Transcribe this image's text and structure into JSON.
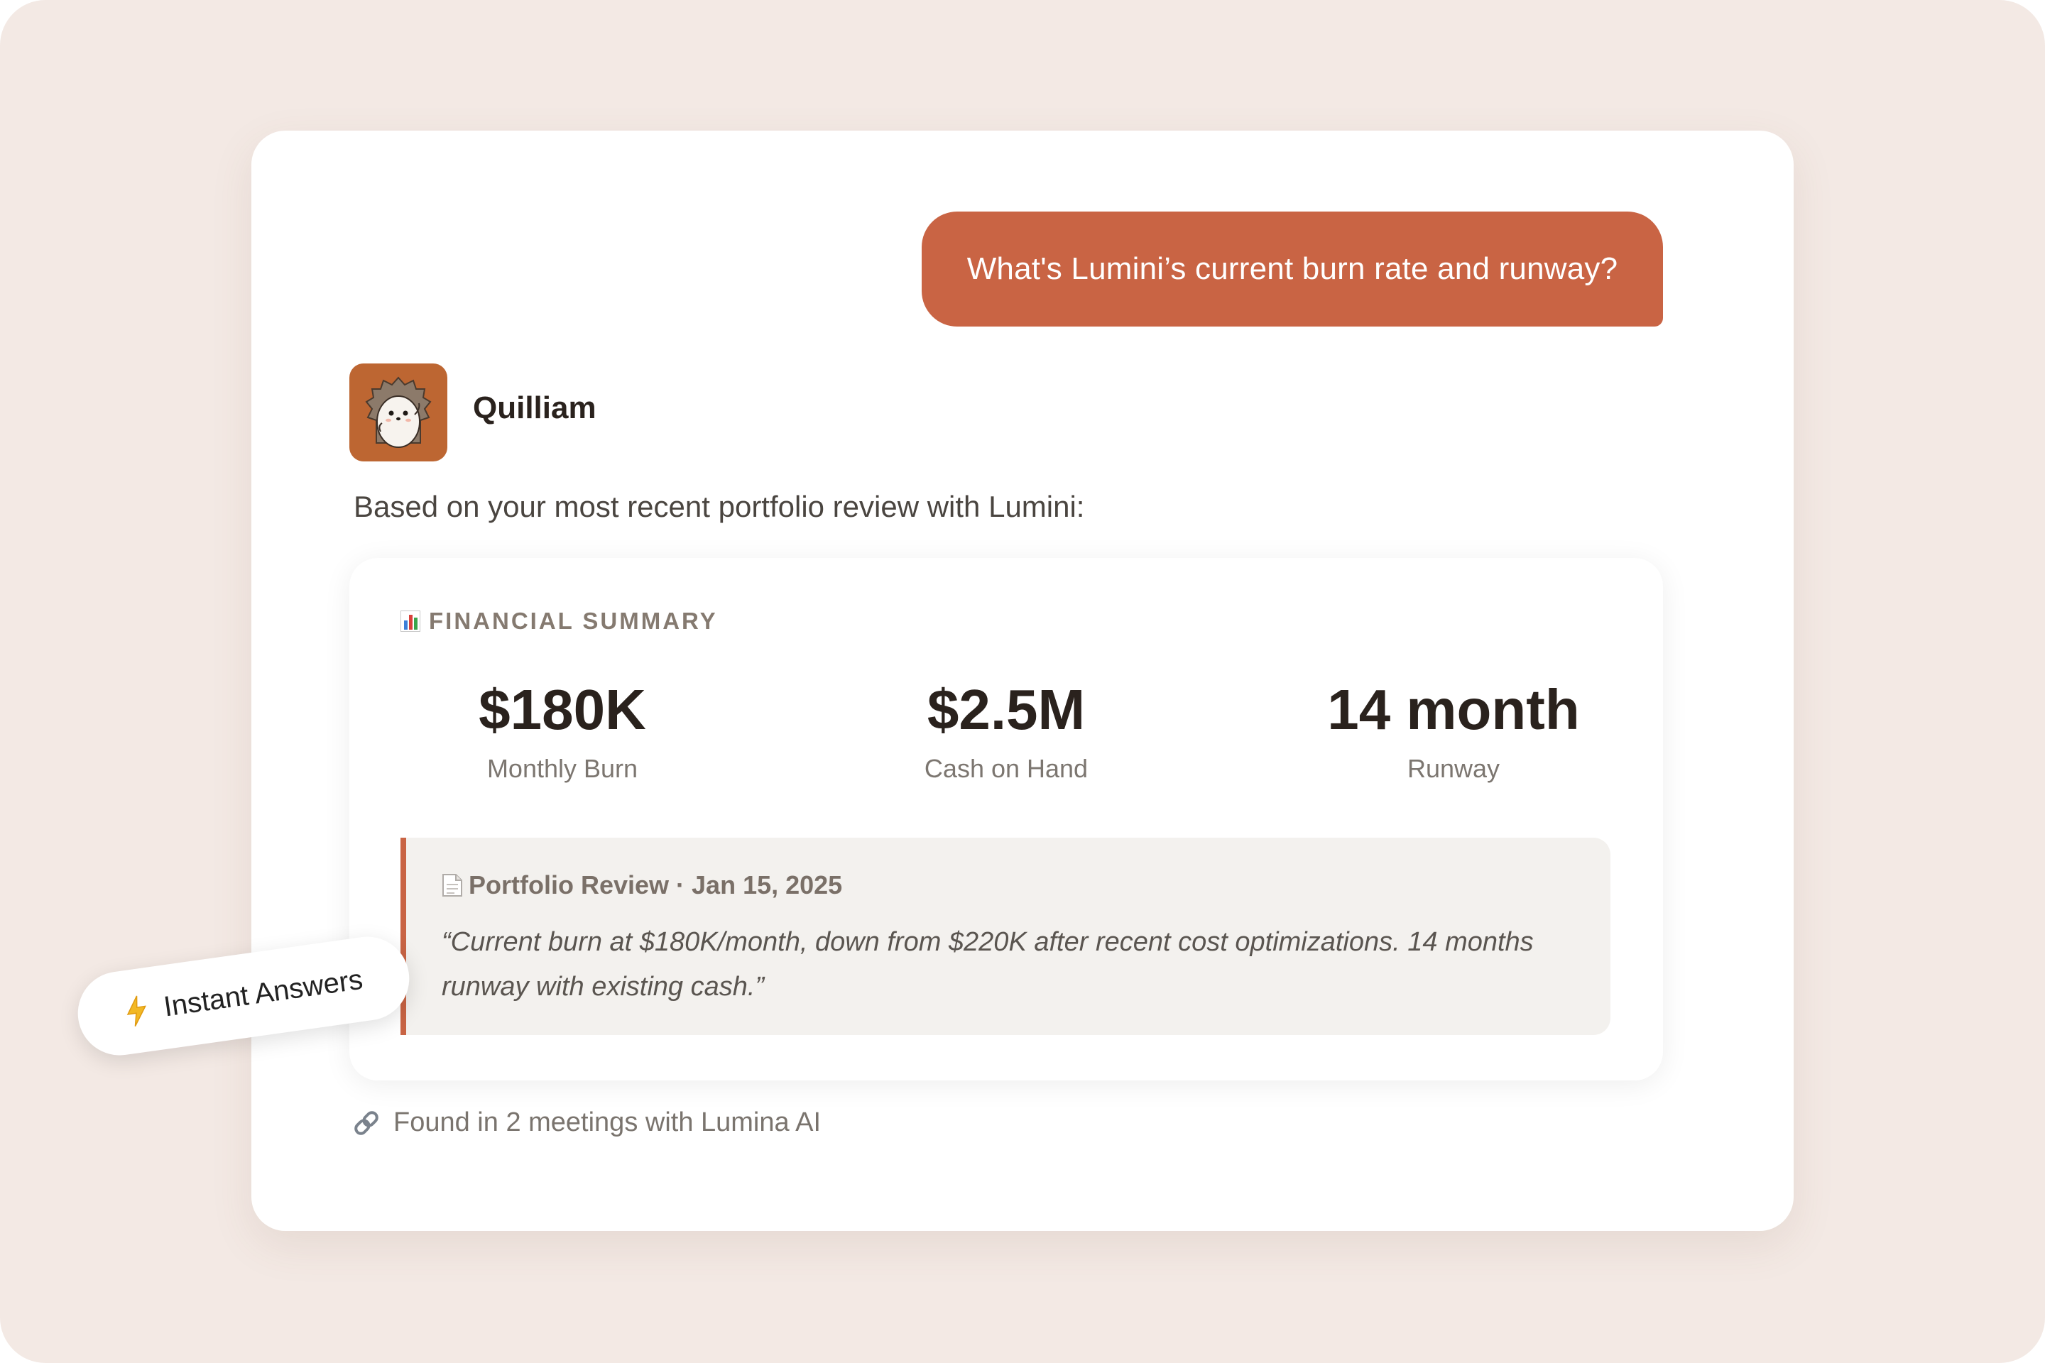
{
  "chat": {
    "user_message": "What's Lumini’s current burn rate and runway?",
    "assistant": {
      "name": "Quilliam",
      "avatar_icon": "hedgehog-avatar-icon",
      "intro": "Based on your most recent portfolio review with Lumini:"
    }
  },
  "summary": {
    "icon": "bar-chart-icon",
    "title": "FINANCIAL SUMMARY",
    "metrics": [
      {
        "value": "$180K",
        "label": "Monthly Burn"
      },
      {
        "value": "$2.5M",
        "label": "Cash on Hand"
      },
      {
        "value": "14 month",
        "label": "Runway"
      }
    ],
    "source": {
      "icon": "document-icon",
      "title": "Portfolio Review · Jan 15, 2025",
      "quote_line1": "“Current burn at $180K/month, down from $220K after recent cost optimizations. 14 months",
      "quote_line2": "runway with existing cash.”"
    }
  },
  "footer": {
    "icon": "link-icon",
    "text": "Found in 2 meetings with Lumina AI"
  },
  "badge": {
    "icon": "lightning-icon",
    "label": "Instant Answers"
  },
  "colors": {
    "accent": "#c96444",
    "background": "#f3e9e4",
    "avatar_bg": "#bd6632",
    "quote_bg": "#f3f1ee"
  }
}
